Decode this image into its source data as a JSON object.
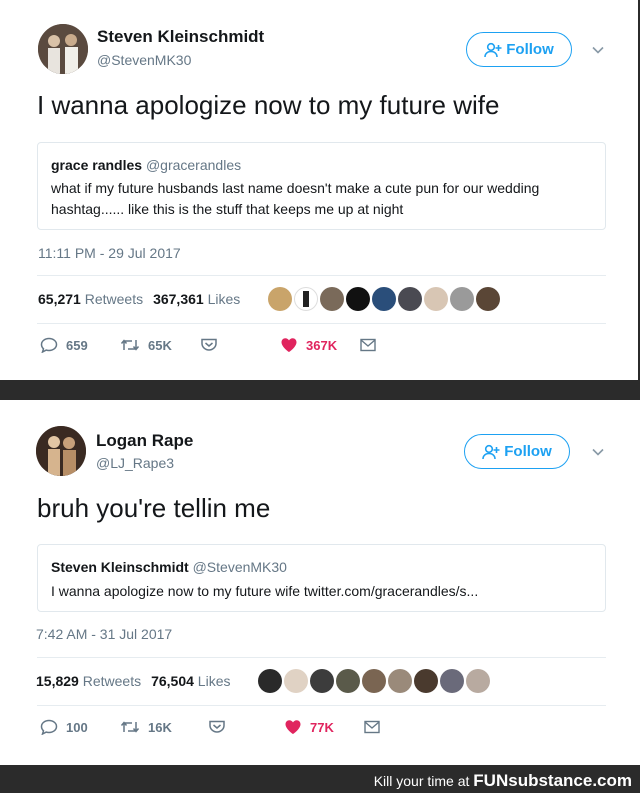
{
  "tweets": [
    {
      "author_name": "Steven Kleinschmidt",
      "author_handle": "@StevenMK30",
      "follow_label": "Follow",
      "text": "I wanna apologize now to my future wife",
      "quote": {
        "author_name": "grace randles",
        "author_handle": "@gracerandles",
        "text": "what if my future husbands last name doesn't make a cute pun for our wedding hashtag...... like this is the stuff that keeps me up at night"
      },
      "timestamp": "11:11 PM - 29 Jul 2017",
      "retweets_count": "65,271",
      "retweets_label": "Retweets",
      "likes_count": "367,361",
      "likes_label": "Likes",
      "reply_count": "659",
      "retweet_count_short": "65K",
      "like_count_short": "367K"
    },
    {
      "author_name": "Logan Rape",
      "author_handle": "@LJ_Rape3",
      "follow_label": "Follow",
      "text": "bruh you're tellin me",
      "quote": {
        "author_name": "Steven Kleinschmidt",
        "author_handle": "@StevenMK30",
        "text": "I wanna apologize now to my future wife twitter.com/gracerandles/s..."
      },
      "timestamp": "7:42 AM - 31 Jul 2017",
      "retweets_count": "15,829",
      "retweets_label": "Retweets",
      "likes_count": "76,504",
      "likes_label": "Likes",
      "reply_count": "100",
      "retweet_count_short": "16K",
      "like_count_short": "77K"
    }
  ],
  "footer": {
    "prefix": "Kill your time at",
    "brand": "FUNsubstance.com"
  },
  "colors": {
    "accent": "#1da1f2",
    "like": "#e0245e",
    "muted": "#657786"
  }
}
